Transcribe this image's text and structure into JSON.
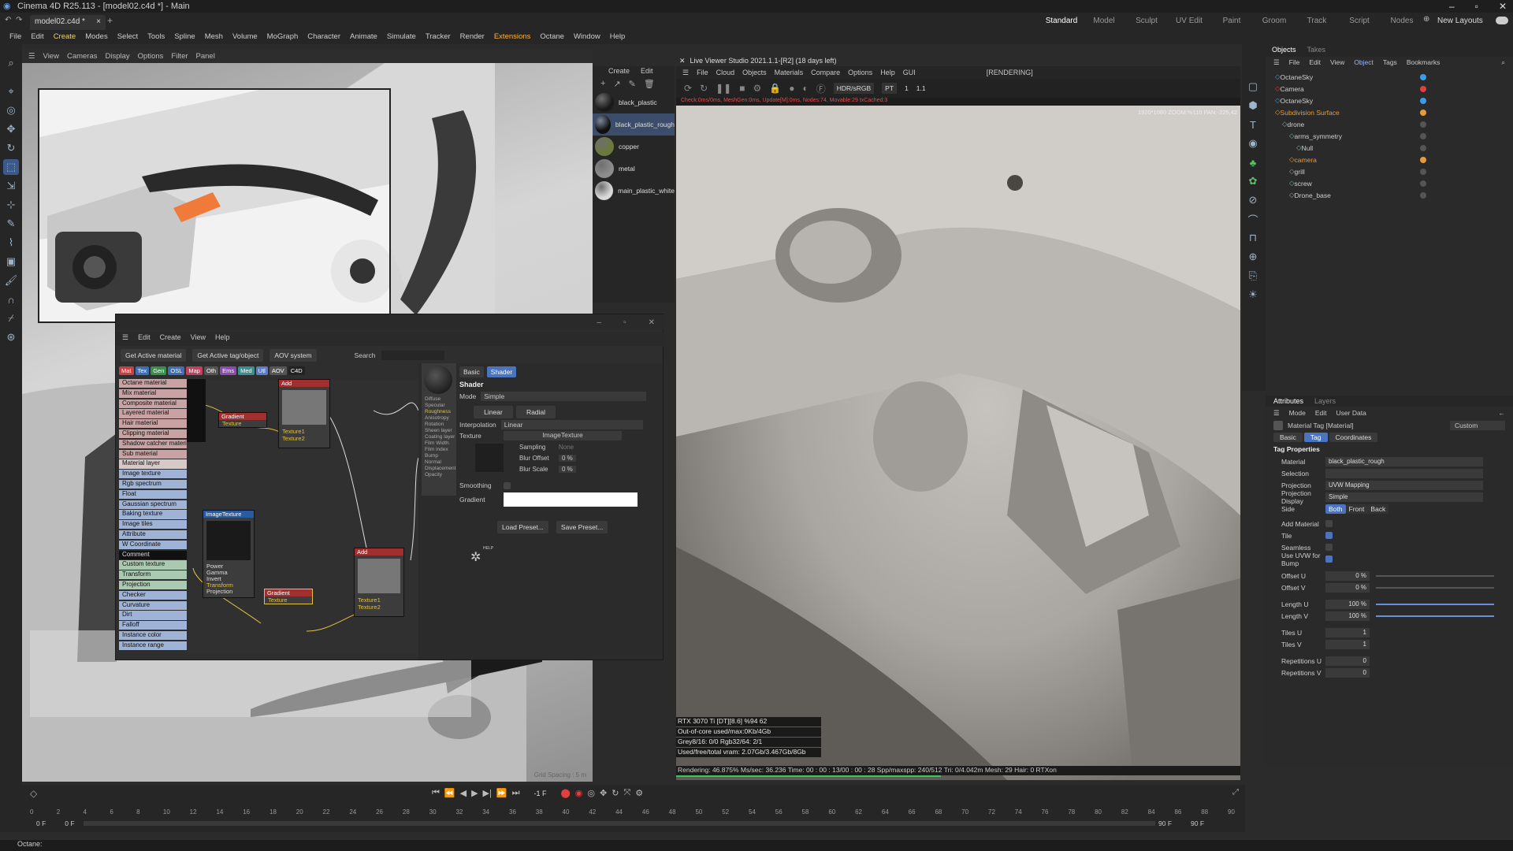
{
  "window": {
    "title": "Cinema 4D R25.113 - [model02.c4d *] - Main",
    "file_tab": "model02.c4d *"
  },
  "layouts": [
    "Standard",
    "Model",
    "Sculpt",
    "UV Edit",
    "Paint",
    "Groom",
    "Track",
    "Script",
    "Nodes"
  ],
  "layouts_active": "Standard",
  "new_layouts": "New Layouts",
  "menubar": [
    "File",
    "Edit",
    "Create",
    "Modes",
    "Select",
    "Tools",
    "Spline",
    "Mesh",
    "Volume",
    "MoGraph",
    "Character",
    "Animate",
    "Simulate",
    "Tracker",
    "Render",
    "Extensions",
    "Octane",
    "Window",
    "Help"
  ],
  "viewport": {
    "menu": [
      "View",
      "Cameras",
      "Display",
      "Options",
      "Filter",
      "Panel"
    ],
    "grid_spacing": "Grid Spacing : 5 m"
  },
  "material_manager": {
    "menu": [
      "Create",
      "Edit"
    ],
    "materials": [
      {
        "name": "black_plastic",
        "color": "#1a1a1a"
      },
      {
        "name": "black_plastic_rough",
        "color": "#101010"
      },
      {
        "name": "copper",
        "color": "#6b7a3a"
      },
      {
        "name": "metal",
        "color": "#8d8d8d"
      },
      {
        "name": "main_plastic_white",
        "color": "#d8d8d8"
      }
    ],
    "selected": "black_plastic_rough"
  },
  "node_editor": {
    "menu": [
      "Edit",
      "Create",
      "View",
      "Help"
    ],
    "buttons": [
      "Get Active material",
      "Get Active tag/object",
      "AOV system"
    ],
    "search_label": "Search",
    "category_tabs": [
      {
        "label": "Mat",
        "color": "#c94040"
      },
      {
        "label": "Tex",
        "color": "#3c6fb8"
      },
      {
        "label": "Gen",
        "color": "#3a8e4a"
      },
      {
        "label": "OSL",
        "color": "#3c6fb8"
      },
      {
        "label": "Map",
        "color": "#c04060"
      },
      {
        "label": "Oth",
        "color": "#555555"
      },
      {
        "label": "Ems",
        "color": "#8a4ab0"
      },
      {
        "label": "Med",
        "color": "#3c8e8e"
      },
      {
        "label": "Utl",
        "color": "#5a7bd0"
      },
      {
        "label": "AOV",
        "color": "#555555"
      },
      {
        "label": "C4D",
        "color": "#222222"
      }
    ],
    "node_list": [
      "Octane material",
      "Mix material",
      "Composite material",
      "Layered material",
      "Hair material",
      "Clipping material",
      "Shadow catcher material",
      "Sub material",
      "Material layer",
      "Image texture",
      "Rgb spectrum",
      "Float",
      "Gaussian spectrum",
      "Baking texture",
      "Image tiles",
      "Attribute",
      "W Coordinate",
      "Comment",
      "Custom texture",
      "Transform",
      "Projection",
      "Checker",
      "Curvature",
      "Dirt",
      "Falloff",
      "Instance color",
      "Instance range"
    ],
    "nodes": [
      {
        "title": "Gradient",
        "ports": [
          "Texture"
        ]
      },
      {
        "title": "Add",
        "ports": [
          "Texture1",
          "Texture2"
        ]
      },
      {
        "title": "ImageTexture",
        "ports": [
          "Power",
          "Gamma",
          "Invert",
          "Transform",
          "Projection"
        ]
      },
      {
        "title": "Gradient",
        "ports": [
          "Texture"
        ]
      },
      {
        "title": "Add",
        "ports": [
          "Texture1",
          "Texture2"
        ]
      }
    ],
    "material_ports": [
      "Diffuse",
      "Specular",
      "Roughness",
      "Anisotropy",
      "Rotation",
      "Sheen layer",
      "Coating layer",
      "Film Width",
      "Film index",
      "Bump",
      "Normal",
      "Displacement",
      "Opacity"
    ],
    "shader": {
      "tabs": [
        "Basic",
        "Shader"
      ],
      "active_tab": "Shader",
      "heading": "Shader",
      "mode_label": "Mode",
      "mode_value": "Simple",
      "type_buttons": [
        "Linear",
        "Radial"
      ],
      "interpolation_label": "Interpolation",
      "interpolation_value": "Linear",
      "texture_label": "Texture",
      "texture_value": "ImageTexture",
      "sampling_label": "Sampling",
      "sampling_value": "None",
      "blur_offset_label": "Blur Offset",
      "blur_offset_value": "0 %",
      "blur_scale_label": "Blur Scale",
      "blur_scale_value": "0 %",
      "smoothing_label": "Smoothing",
      "gradient_label": "Gradient",
      "load_preset": "Load Preset...",
      "save_preset": "Save Preset...",
      "help": "HELP"
    }
  },
  "live_viewer": {
    "title": "Live Viewer Studio 2021.1.1-[R2] (18 days left)",
    "menu": [
      "File",
      "Cloud",
      "Objects",
      "Materials",
      "Compare",
      "Options",
      "Help",
      "GUI"
    ],
    "state": "[RENDERING]",
    "color_space": "HDR/sRGB",
    "mode": "PT",
    "frame": "1",
    "zoom": "1.1",
    "status_line": "Check:0ms/0ms, MeshGen:0ms, Update[M]:0ms, Nodes:74, Movable:29 txCached:3",
    "overlay": "1920*1080 ZOOM:%110  PAN:-225,42",
    "stats": [
      "RTX 3070 Ti [DT][8.6]      %94      62",
      "Out-of-core used/max:0Kb/4Gb",
      "Grey8/16: 0/0          Rgb32/64: 2/1",
      "Used/free/total vram: 2.07Gb/3.467Gb/8Gb"
    ],
    "render_status": "Rendering: 46.875%  Ms/sec: 36.236   Time: 00 : 00 : 13/00 : 00 : 28  Spp/maxspp: 240/512   Tri: 0/4.042m   Mesh: 29   Hair: 0   RTXon",
    "progress": 0.46875
  },
  "objects_panel": {
    "tabs": [
      "Objects",
      "Takes"
    ],
    "menu": [
      "File",
      "Edit",
      "View",
      "Object",
      "Tags",
      "Bookmarks"
    ],
    "tree": [
      {
        "name": "OctaneSky",
        "indent": 0,
        "color": "#3a9be8"
      },
      {
        "name": "Camera",
        "indent": 0,
        "color": "#e04040"
      },
      {
        "name": "OctaneSky",
        "indent": 0,
        "color": "#3a9be8"
      },
      {
        "name": "Subdivision Surface",
        "indent": 0,
        "color": "#e89a3a"
      },
      {
        "name": "drone",
        "indent": 1,
        "color": ""
      },
      {
        "name": "arms_symmetry",
        "indent": 2,
        "color": ""
      },
      {
        "name": "Null",
        "indent": 3,
        "color": ""
      },
      {
        "name": "camera",
        "indent": 2,
        "color": "#e89a3a"
      },
      {
        "name": "grill",
        "indent": 2,
        "color": ""
      },
      {
        "name": "screw",
        "indent": 2,
        "color": ""
      },
      {
        "name": "Drone_base",
        "indent": 2,
        "color": ""
      }
    ]
  },
  "attributes": {
    "tabs": [
      "Attributes",
      "Layers"
    ],
    "menu": [
      "Mode",
      "Edit",
      "User Data"
    ],
    "title": "Material Tag [Material]",
    "preset": "Custom",
    "subtabs": [
      "Basic",
      "Tag",
      "Coordinates"
    ],
    "active_subtab": "Tag",
    "section": "Tag Properties",
    "fields": [
      {
        "label": "Material",
        "value": "black_plastic_rough"
      },
      {
        "label": "Selection",
        "value": ""
      },
      {
        "label": "Projection",
        "value": "UVW Mapping"
      },
      {
        "label": "Projection Display",
        "value": "Simple"
      }
    ],
    "side_label": "Side",
    "side_options": [
      "Both",
      "Front",
      "Back"
    ],
    "side_active": "Both",
    "checks": [
      {
        "label": "Add Material",
        "on": false
      },
      {
        "label": "Tile",
        "on": true
      },
      {
        "label": "Seamless",
        "on": false
      },
      {
        "label": "Use UVW for Bump",
        "on": true
      }
    ],
    "numbers": [
      {
        "label": "Offset U",
        "value": "0 %"
      },
      {
        "label": "Offset V",
        "value": "0 %"
      },
      {
        "label": "Length U",
        "value": "100 %"
      },
      {
        "label": "Length V",
        "value": "100 %"
      },
      {
        "label": "Tiles U",
        "value": "1"
      },
      {
        "label": "Tiles V",
        "value": "1"
      },
      {
        "label": "Repetitions U",
        "value": "0"
      },
      {
        "label": "Repetitions V",
        "value": "0"
      }
    ]
  },
  "timeline": {
    "current_frame": "-1 F",
    "start": "0 F",
    "start2": "0 F",
    "end": "90 F",
    "end2": "90 F",
    "ticks": [
      "0",
      "2",
      "4",
      "6",
      "8",
      "10",
      "12",
      "14",
      "16",
      "18",
      "20",
      "22",
      "24",
      "26",
      "28",
      "30",
      "32",
      "34",
      "36",
      "38",
      "40",
      "42",
      "44",
      "46",
      "48",
      "50",
      "52",
      "54",
      "56",
      "58",
      "60",
      "62",
      "64",
      "66",
      "68",
      "70",
      "72",
      "74",
      "76",
      "78",
      "80",
      "82",
      "84",
      "86",
      "88",
      "90"
    ]
  },
  "statusbar": "Octane:"
}
